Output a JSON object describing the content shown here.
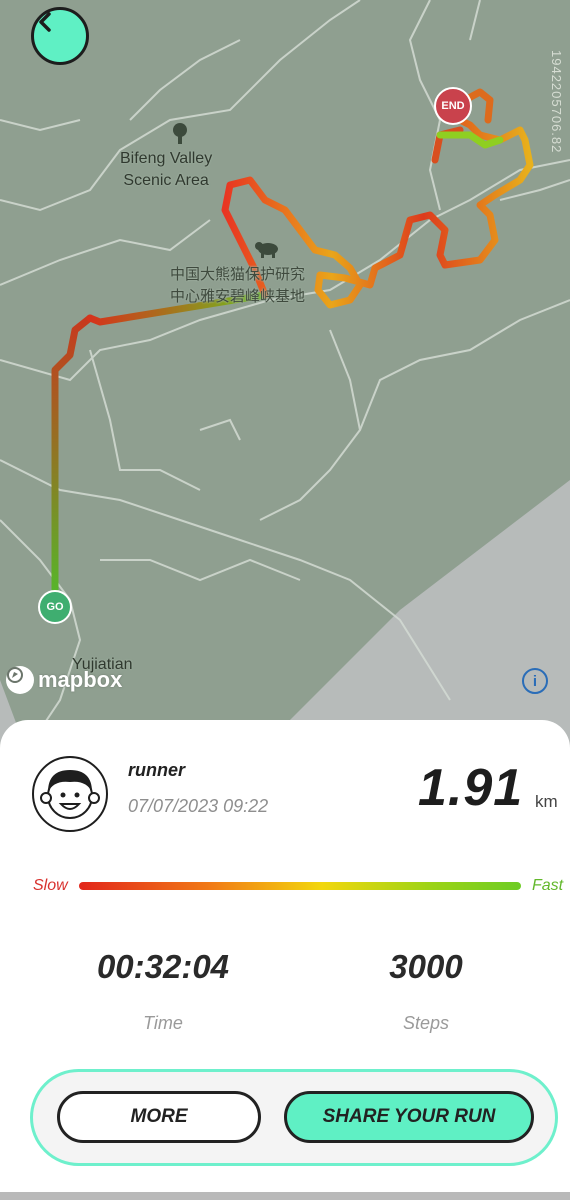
{
  "map": {
    "labels": {
      "scenic_area": "Bifeng Valley\nScenic Area",
      "reserve": "中国大熊猫保护研究\n中心雅安碧峰峡基地",
      "village": "Yujiatian"
    },
    "watermark": "1942205706.82",
    "attribution": "mapbox",
    "info_symbol": "i",
    "start_marker": "GO",
    "end_marker": "END"
  },
  "run": {
    "user": "runner",
    "datetime": "07/07/2023 09:22",
    "distance": "1.91",
    "distance_unit": "km",
    "speed_legend": {
      "slow": "Slow",
      "fast": "Fast"
    },
    "stats": [
      {
        "value": "00:32:04",
        "label": "Time"
      },
      {
        "value": "3000",
        "label": "Steps"
      }
    ]
  },
  "actions": {
    "more": "MORE",
    "share": "SHARE YOUR RUN"
  },
  "colors": {
    "accent": "#5ff0c4",
    "slow": "#d8322f",
    "fast": "#62b82b",
    "map_bg": "#8f9f90"
  },
  "icons": [
    "back-arrow-icon",
    "tree-icon",
    "panda-icon",
    "mapbox-icon",
    "info-icon"
  ]
}
